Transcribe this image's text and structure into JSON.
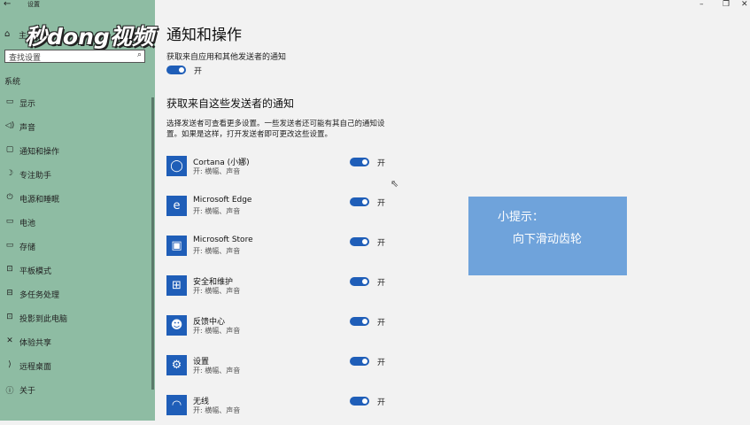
{
  "window": {
    "title": "设置",
    "back": "←",
    "minimize": "–",
    "restore": "❐",
    "close": "✕"
  },
  "sidebar": {
    "home_label": "主",
    "watermark": "秒dong视频",
    "search_placeholder": "查找设置",
    "section": "系统",
    "items": [
      {
        "icon": "▭",
        "label": "显示"
      },
      {
        "icon": "◁)",
        "label": "声音"
      },
      {
        "icon": "▢",
        "label": "通知和操作"
      },
      {
        "icon": "☽",
        "label": "专注助手"
      },
      {
        "icon": "⏻",
        "label": "电源和睡眠"
      },
      {
        "icon": "▭",
        "label": "电池"
      },
      {
        "icon": "▭",
        "label": "存储"
      },
      {
        "icon": "⊡",
        "label": "平板模式"
      },
      {
        "icon": "⊟",
        "label": "多任务处理"
      },
      {
        "icon": "⊡",
        "label": "投影到此电脑"
      },
      {
        "icon": "✕",
        "label": "体验共享"
      },
      {
        "icon": "⟩",
        "label": "远程桌面"
      },
      {
        "icon": "ⓘ",
        "label": "关于"
      }
    ]
  },
  "main": {
    "title": "通知和操作",
    "get_notif_label": "获取来自应用和其他发送者的通知",
    "get_notif_state": "开",
    "senders_heading": "获取来自这些发送者的通知",
    "senders_desc": "选择发送者可查看更多设置。一些发送者还可能有其自己的通知设置。如果是这样，打开发送者即可更改这些设置。",
    "apps": [
      {
        "name": "Cortana (小娜)",
        "sub": "开: 横幅、声音",
        "state": "开",
        "icon": "◯"
      },
      {
        "name": "Microsoft Edge",
        "sub": "开: 横幅、声音",
        "state": "开",
        "icon": "e"
      },
      {
        "name": "Microsoft Store",
        "sub": "开: 横幅、声音",
        "state": "开",
        "icon": "▣"
      },
      {
        "name": "安全和维护",
        "sub": "开: 横幅、声音",
        "state": "开",
        "icon": "⊞"
      },
      {
        "name": "反馈中心",
        "sub": "开: 横幅、声音",
        "state": "开",
        "icon": "☻"
      },
      {
        "name": "设置",
        "sub": "开: 横幅、声音",
        "state": "开",
        "icon": "⚙"
      },
      {
        "name": "无线",
        "sub": "开: 横幅、声音",
        "state": "开",
        "icon": "◠"
      }
    ]
  },
  "hint": {
    "title": "小提示：",
    "text": "向下滑动齿轮"
  }
}
